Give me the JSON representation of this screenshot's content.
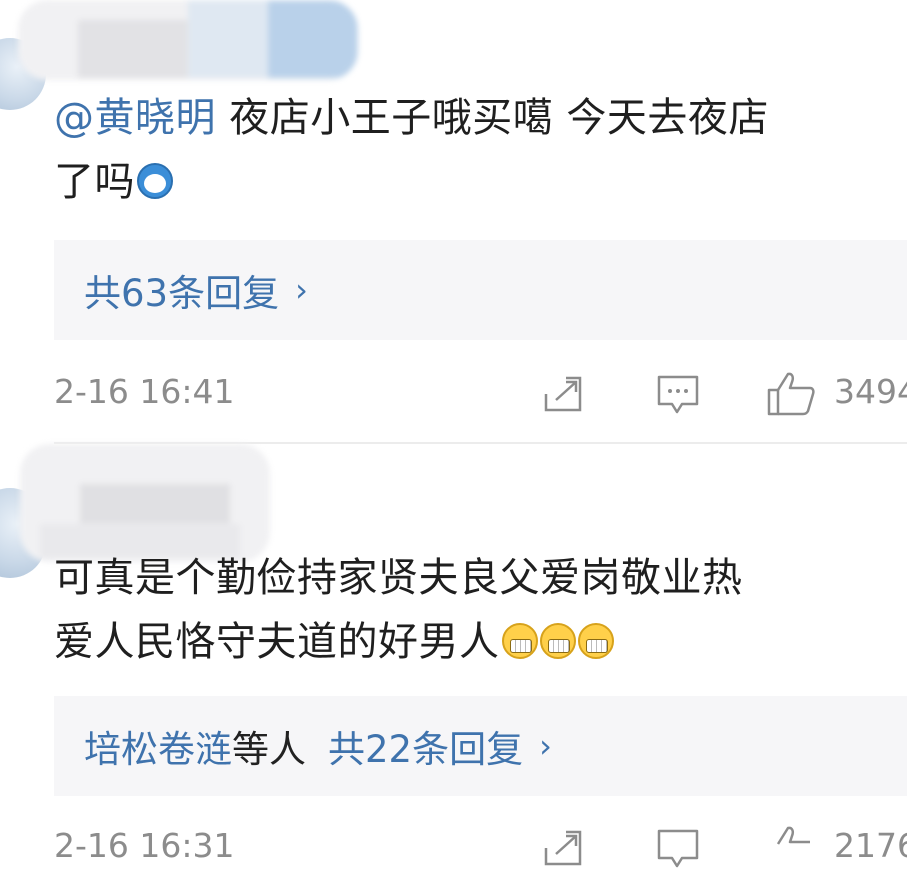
{
  "comments": [
    {
      "mention": "@黄晓明",
      "text_line1": " 夜店小王子哦买噶 今天去夜店",
      "text_line2": "了吗",
      "reply_box": {
        "label": "共63条回复"
      },
      "timestamp": "2-16 16:41",
      "likes": "3494"
    },
    {
      "text_line1": "可真是个勤俭持家贤夫良父爱岗敬业热",
      "text_line2": "爱人民恪守夫道的好男人",
      "reply_box": {
        "others": "培松卷涟",
        "others_suffix": "等人",
        "label": "共22条回复"
      },
      "timestamp": "2-16 16:31",
      "likes": "2176"
    }
  ],
  "icons": {
    "forward": "share-forward-icon",
    "comment": "comment-bubble-icon",
    "like": "thumbs-up-icon",
    "emoji_1": "doraemon-emoji",
    "emoji_2": "grin-emoji"
  },
  "colors": {
    "link": "#3f73ad",
    "meta": "#8c8c8c",
    "reply_bg": "#f6f6f8"
  }
}
